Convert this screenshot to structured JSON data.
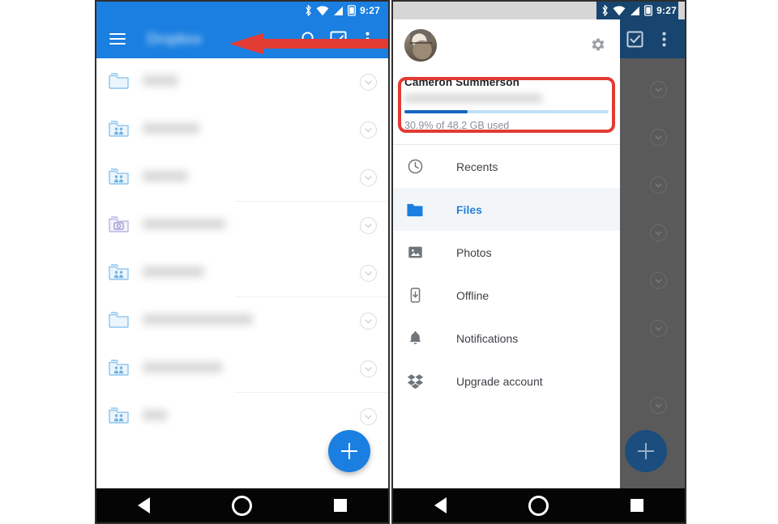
{
  "meta": {
    "description": "Two Android phone screenshots of the Dropbox app side by side, with red annotations"
  },
  "status_bar": {
    "time": "9:27",
    "icons": [
      "bluetooth-icon",
      "wifi-icon",
      "signal-icon",
      "battery-icon"
    ]
  },
  "left_phone": {
    "toolbar": {
      "menu_label": "hamburger-menu",
      "title": "Dropbox",
      "actions": [
        "search-icon",
        "select-checkbox-icon",
        "overflow-menu-icon"
      ]
    },
    "file_rows": [
      {
        "icon": "folder-icon",
        "name": "",
        "name_width": 44,
        "action": "chevron-down-icon"
      },
      {
        "icon": "shared-folder-icon",
        "name": "",
        "name_width": 70,
        "action": "chevron-down-icon"
      },
      {
        "icon": "shared-folder-icon",
        "name": "",
        "name_width": 56,
        "action": "chevron-down-icon"
      },
      {
        "icon": "camera-folder-icon",
        "name": "",
        "name_width": 102,
        "action": "chevron-down-icon"
      },
      {
        "icon": "shared-folder-icon",
        "name": "",
        "name_width": 76,
        "action": "chevron-down-icon"
      },
      {
        "icon": "folder-icon",
        "name": "",
        "name_width": 136,
        "action": "chevron-down-icon"
      },
      {
        "icon": "shared-folder-icon",
        "name": "",
        "name_width": 98,
        "action": "chevron-down-icon"
      },
      {
        "icon": "shared-folder-icon",
        "name": "",
        "name_width": 30,
        "action": "chevron-down-icon"
      }
    ],
    "fab": {
      "label": "+",
      "name": "create-new-fab"
    },
    "annotation": {
      "type": "arrow",
      "direction": "left",
      "color": "#e23b33",
      "target": "hamburger-menu"
    }
  },
  "right_phone": {
    "toolbar": {
      "actions": [
        "select-checkbox-icon",
        "overflow-menu-icon"
      ]
    },
    "drawer": {
      "account": {
        "name": "Cameron Summerson",
        "email": "",
        "usage_text": "30.9% of 48.2 GB used",
        "usage_percent": 30.9,
        "total_storage": "48.2 GB",
        "settings_icon": "gear-icon",
        "avatar": "user-avatar"
      },
      "items": [
        {
          "label": "Recents",
          "icon": "clock-icon",
          "selected": false
        },
        {
          "label": "Files",
          "icon": "folder-icon",
          "selected": true
        },
        {
          "label": "Photos",
          "icon": "photo-icon",
          "selected": false
        },
        {
          "label": "Offline",
          "icon": "offline-download-icon",
          "selected": false
        },
        {
          "label": "Notifications",
          "icon": "bell-icon",
          "selected": false
        },
        {
          "label": "Upgrade account",
          "icon": "dropbox-icon",
          "selected": false
        }
      ],
      "annotation": {
        "type": "rounded-rect-highlight",
        "color": "#e23b33",
        "target": "account-info"
      }
    },
    "fab": {
      "label": "+",
      "name": "create-new-fab"
    }
  },
  "nav_bar": {
    "buttons": [
      {
        "name": "android-back-button",
        "glyph": "triangle-left"
      },
      {
        "name": "android-home-button",
        "glyph": "circle"
      },
      {
        "name": "android-recents-button",
        "glyph": "square"
      }
    ]
  },
  "colors": {
    "toolbar_blue": "#1a7fe0",
    "toolbar_blue_dim": "#17456f",
    "annotation_red": "#e23b33",
    "progress_fill": "#1565c0",
    "progress_track": "#bfe0f5",
    "scrim_gray": "#5a5a5a",
    "selected_row": "#f3f6f9",
    "accent_link": "#2680d8"
  }
}
